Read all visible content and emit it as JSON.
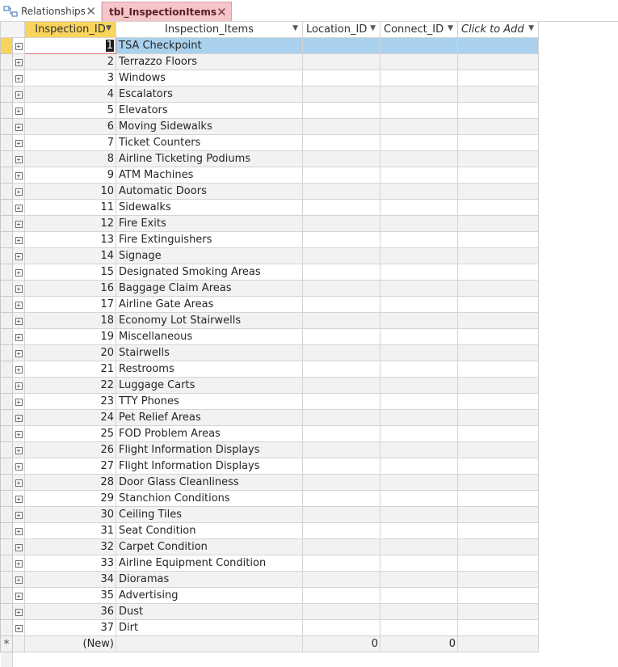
{
  "tabs": [
    {
      "label": "Relationships",
      "icon": "relationships-icon",
      "active": false
    },
    {
      "label": "tbl_InspectionItems",
      "icon": "table-icon",
      "active": true
    }
  ],
  "columns": [
    "Inspection_ID",
    "Inspection_Items",
    "Location_ID",
    "Connect_ID",
    "Click to Add"
  ],
  "rows": [
    {
      "id": "1",
      "item": "TSA Checkpoint"
    },
    {
      "id": "2",
      "item": "Terrazzo Floors"
    },
    {
      "id": "3",
      "item": "Windows"
    },
    {
      "id": "4",
      "item": "Escalators"
    },
    {
      "id": "5",
      "item": "Elevators"
    },
    {
      "id": "6",
      "item": "Moving Sidewalks"
    },
    {
      "id": "7",
      "item": "Ticket Counters"
    },
    {
      "id": "8",
      "item": "Airline Ticketing Podiums"
    },
    {
      "id": "9",
      "item": "ATM Machines"
    },
    {
      "id": "10",
      "item": "Automatic Doors"
    },
    {
      "id": "11",
      "item": "Sidewalks"
    },
    {
      "id": "12",
      "item": "Fire Exits"
    },
    {
      "id": "13",
      "item": "Fire Extinguishers"
    },
    {
      "id": "14",
      "item": "Signage"
    },
    {
      "id": "15",
      "item": "Designated Smoking Areas"
    },
    {
      "id": "16",
      "item": "Baggage Claim Areas"
    },
    {
      "id": "17",
      "item": "Airline Gate Areas"
    },
    {
      "id": "18",
      "item": "Economy Lot Stairwells"
    },
    {
      "id": "19",
      "item": "Miscellaneous"
    },
    {
      "id": "20",
      "item": "Stairwells"
    },
    {
      "id": "21",
      "item": "Restrooms"
    },
    {
      "id": "22",
      "item": "Luggage Carts"
    },
    {
      "id": "23",
      "item": "TTY Phones"
    },
    {
      "id": "24",
      "item": "Pet Relief Areas"
    },
    {
      "id": "25",
      "item": "FOD Problem Areas"
    },
    {
      "id": "26",
      "item": "Flight Information Displays"
    },
    {
      "id": "27",
      "item": "Flight Information Displays"
    },
    {
      "id": "28",
      "item": "Door Glass Cleanliness"
    },
    {
      "id": "29",
      "item": "Stanchion Conditions"
    },
    {
      "id": "30",
      "item": "Ceiling Tiles"
    },
    {
      "id": "31",
      "item": "Seat Condition"
    },
    {
      "id": "32",
      "item": "Carpet Condition"
    },
    {
      "id": "33",
      "item": "Airline Equipment Condition"
    },
    {
      "id": "34",
      "item": "Dioramas"
    },
    {
      "id": "35",
      "item": "Advertising"
    },
    {
      "id": "36",
      "item": "Dust"
    },
    {
      "id": "37",
      "item": "Dirt"
    }
  ],
  "new_row": {
    "marker": "*",
    "id": "(New)",
    "location_id": "0",
    "connect_id": "0"
  },
  "colors": {
    "active_column": "#f9d45d",
    "selected_row": "#a9d1ee",
    "active_tab": "#f4c6c9"
  }
}
